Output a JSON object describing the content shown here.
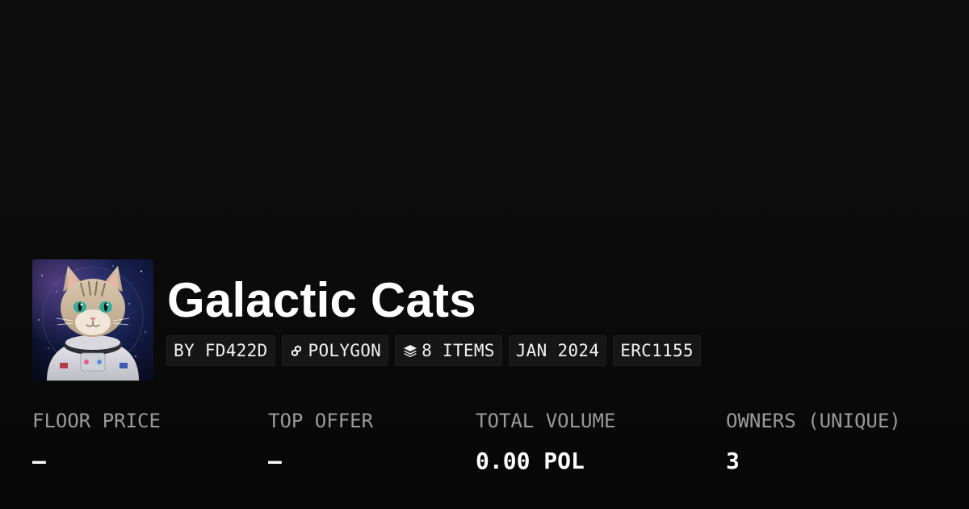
{
  "collection": {
    "title": "Galactic Cats",
    "image_alt": "astronaut-cat-artwork"
  },
  "chips": [
    {
      "label": "BY FD422D",
      "icon": ""
    },
    {
      "label": "POLYGON",
      "icon": "chain-link-icon"
    },
    {
      "label": "8 ITEMS",
      "icon": "layers-icon"
    },
    {
      "label": "JAN 2024",
      "icon": ""
    },
    {
      "label": "ERC1155",
      "icon": ""
    }
  ],
  "stats": [
    {
      "label": "FLOOR PRICE",
      "value": "–"
    },
    {
      "label": "TOP OFFER",
      "value": "–"
    },
    {
      "label": "TOTAL VOLUME",
      "value": "0.00 POL"
    },
    {
      "label": "OWNERS (UNIQUE)",
      "value": "3"
    }
  ],
  "colors": {
    "background": "#0b0b0b",
    "chip_background": "#161616",
    "label_gray": "#9a9a9a",
    "text_white": "#ffffff"
  }
}
